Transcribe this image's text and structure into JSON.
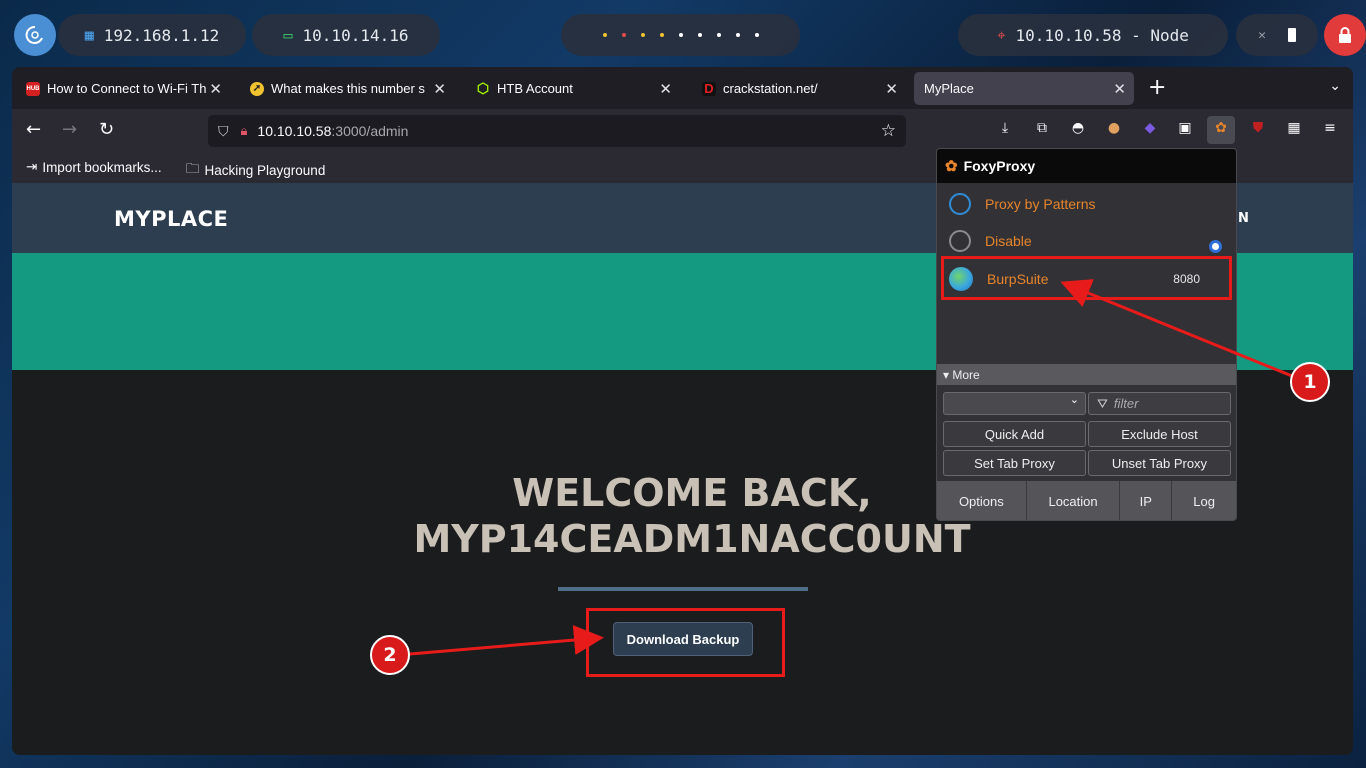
{
  "desktop": {
    "ip_local": "192.168.1.12",
    "ip_vpn": "10.10.14.16",
    "target": "10.10.10.58 - Node"
  },
  "browser": {
    "tabs": [
      {
        "title": "How to Connect to Wi-Fi Th",
        "favicon": "hub-red-icon"
      },
      {
        "title": "What makes this number s",
        "favicon": "rocket-yellow-icon"
      },
      {
        "title": "HTB Account",
        "favicon": "htb-cube-icon"
      },
      {
        "title": "crackstation.net/",
        "favicon": "crackstation-d-icon"
      },
      {
        "title": "MyPlace",
        "favicon": "none"
      }
    ],
    "url_host": "10.10.10.58",
    "url_path": ":3000/admin",
    "bookmarks": [
      "Import bookmarks...",
      "Hacking Playground"
    ]
  },
  "site": {
    "logo": "MYPLACE",
    "nav_partial": "N",
    "welcome_line1": "WELCOME BACK,",
    "welcome_line2": "MYP14CEADM1NACC0UNT",
    "download_button": "Download Backup"
  },
  "foxyproxy": {
    "title": "FoxyProxy",
    "items": [
      {
        "label": "Proxy by Patterns"
      },
      {
        "label": "Disable"
      },
      {
        "label": "BurpSuite",
        "port": "8080"
      }
    ],
    "more_label": "▾ More",
    "filter_placeholder": "filter",
    "buttons": [
      "Quick Add",
      "Exclude Host",
      "Set Tab Proxy",
      "Unset Tab Proxy"
    ],
    "footer": [
      "Options",
      "Location",
      "IP",
      "Log"
    ]
  },
  "annotations": {
    "badge_1": "1",
    "badge_2": "2",
    "color": "#e81b1b"
  }
}
